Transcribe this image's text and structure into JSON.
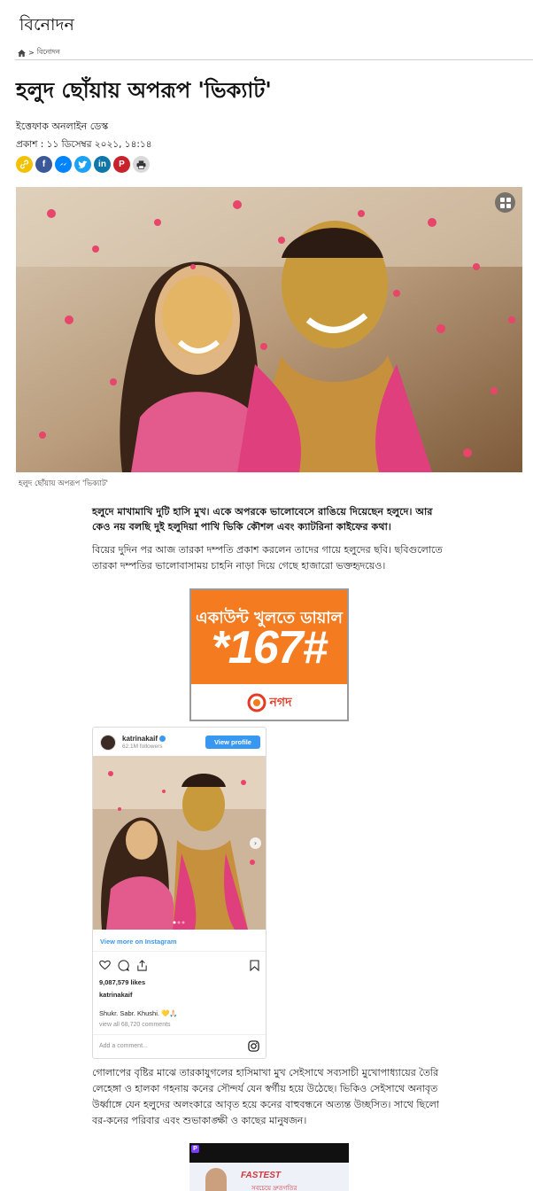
{
  "section": {
    "title": "বিনোদন"
  },
  "breadcrumb": {
    "separator": ">",
    "current": "বিনোদন"
  },
  "article": {
    "headline": "হলুদ ছোঁয়ায় অপরূপ 'ভিক্যাট'",
    "author": "ইত্তেফাক অনলাইন ডেস্ক",
    "published": "প্রকাশ : ১১ ডিসেম্বর ২০২১, ১৪:১৪",
    "image_caption": "হলুদ ছোঁয়ায় অপরূপ 'ভিক্যাট'",
    "lead": "হলুদে মাখামাখি দুটি হাসি মুখ। একে অপরকে ভালোবেসে রাঙিয়ে দিয়েছেন হলুদে। আর কেও নয় বলছি দুই হলুদিয়া পাখি ভিকি কৌশল এবং ক্যাটরিনা কাইফের কথা।",
    "para1": "বিয়ের দুদিন পর আজ তারকা দম্পতি প্রকাশ করলেন তাদের গায়ে হলুদের ছবি। ছবিগুলোতে তারকা দম্পতির ভালোবাসাময় চাহনি নাড়া দিয়ে গেছে হাজারো ভক্তহৃদয়েও।",
    "para2": "গোলাপের বৃষ্টির মাঝে তারকাযুগলের হাসিমাখা মুখ সেইসাথে সব্যসাচী মুখোপাধ্যায়ের তৈরি লেহেঙ্গা ও হালকা গহনায় কনের সৌন্দর্য যেন স্বর্গীয় হয়ে উঠেছে। ভিকিও সেইসাথে অনাবৃত উর্ধ্বাঙ্গে যেন হলুদের অলংকারে আবৃত হয়ে কনের বাহুবন্ধনে অত্যন্ত উচ্ছসিত। সাথে ছিলো বর-কনের পরিবার এবং শুভাকাঙ্ক্ষী ও কাছের মানুষজন।"
  },
  "share": {
    "buttons": [
      {
        "icon": "link-icon",
        "color": "#f2c200"
      },
      {
        "icon": "facebook-icon",
        "color": "#3b5998"
      },
      {
        "icon": "messenger-icon",
        "color": "#0084ff"
      },
      {
        "icon": "twitter-icon",
        "color": "#1da1f2"
      },
      {
        "icon": "linkedin-icon",
        "color": "#0e76a8"
      },
      {
        "icon": "pinterest-icon",
        "color": "#c8232c"
      },
      {
        "icon": "print-icon",
        "color": "#d9d9d9"
      }
    ]
  },
  "ad_nagad": {
    "line1": "একাউন্ট খুলতে ডায়াল",
    "line2": "*167#",
    "brand": "নগদ",
    "color": "#f47b20"
  },
  "instagram": {
    "username": "katrinakaif",
    "followers": "62.1M followers",
    "view_profile": "View profile",
    "view_more": "View more on Instagram",
    "likes": "9,087,579 likes",
    "handle": "katrinakaif",
    "caption": "Shukr. Sabr. Khushi. 💛🙏🏻",
    "view_all": "view all 68,720 comments",
    "add_comment": "Add a comment..."
  },
  "ad_bottom": {
    "badge": "P",
    "headline": "FASTEST",
    "sub": "সবচেয়ে দ্রুতগতির"
  }
}
